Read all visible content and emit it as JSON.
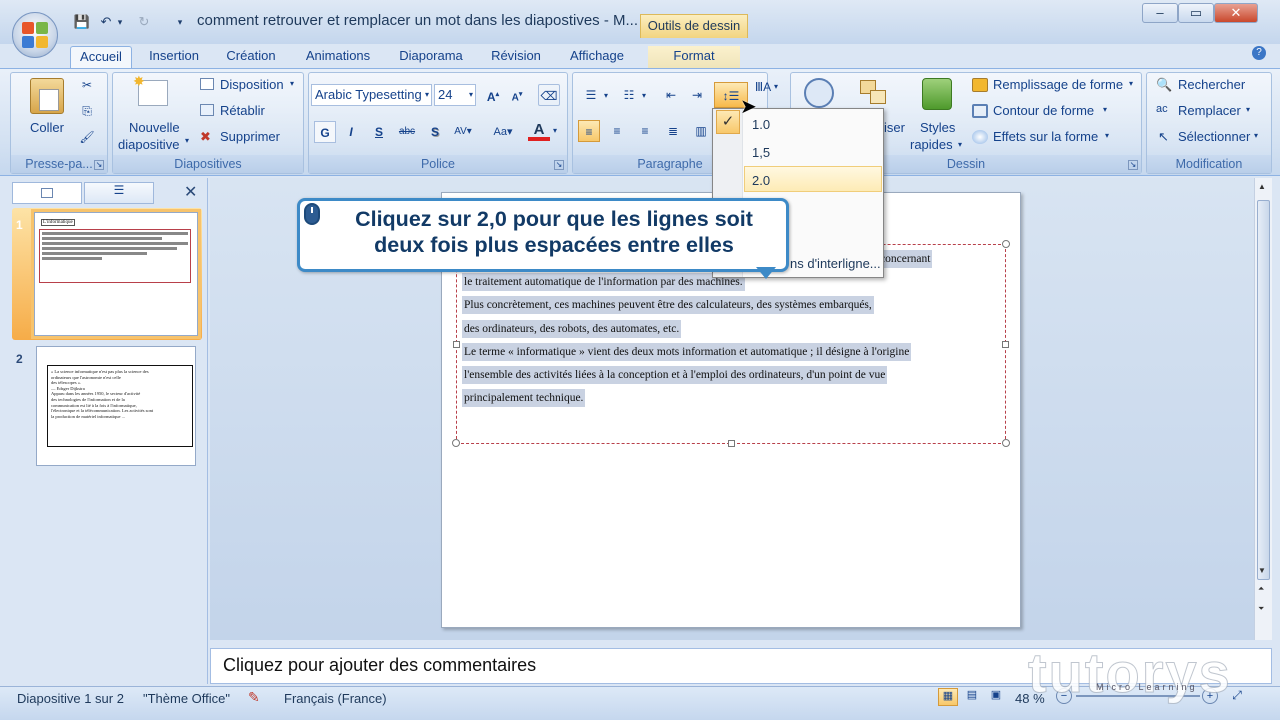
{
  "window": {
    "title": "comment retrouver et remplacer un mot dans les diapostives - M...",
    "context_tab_title": "Outils de dessin",
    "minimize": "‒",
    "maximize": "▭",
    "close": "✕"
  },
  "qat": {
    "save": "💾",
    "undo": "↶",
    "undo_arrow": "▾",
    "redo": "↻",
    "customize": "▾"
  },
  "tabs": [
    "Accueil",
    "Insertion",
    "Création",
    "Animations",
    "Diaporama",
    "Révision",
    "Affichage",
    "Format"
  ],
  "help_icon": "?",
  "ribbon": {
    "clipboard": {
      "paste": "Coller",
      "group": "Presse-pa..."
    },
    "slides": {
      "new_line1": "Nouvelle",
      "new_line2": "diapositive",
      "layout": "Disposition",
      "reset": "Rétablir",
      "delete": "Supprimer",
      "group": "Diapositives"
    },
    "font": {
      "family": "Arabic Typesetting",
      "size": "24",
      "group": "Police"
    },
    "paragraph": {
      "group": "Paragraphe"
    },
    "drawing": {
      "arrange_partial": "iser",
      "styles_line1": "Styles",
      "styles_line2": "rapides",
      "fill": "Remplissage de forme",
      "outline": "Contour de forme",
      "effects": "Effets sur la forme",
      "group": "Dessin"
    },
    "editing": {
      "find": "Rechercher",
      "replace": "Remplacer",
      "select": "Sélectionner",
      "group": "Modification"
    }
  },
  "line_spacing_menu": {
    "items": [
      "1.0",
      "1,5",
      "2.0"
    ],
    "options_partial": "ns d'interligne...",
    "checked": "1.0"
  },
  "callout": {
    "line1": "Cliquez sur 2,0 pour que les lignes soit",
    "line2": "deux fois plus espacées entre elles"
  },
  "slide": {
    "lines": [
      "concernant",
      "le traitement automatique de l'information par des machines.",
      "Plus concrètement, ces machines peuvent être des calculateurs,  des systèmes embarqués,",
      "des ordinateurs, des robots, des automates, etc.",
      "Le terme « informatique » vient des deux mots information et automatique ; il désigne à l'origine",
      "l'ensemble des activités liées à la conception et à l'emploi des ordinateurs, d'un point de vue",
      "principalement technique."
    ]
  },
  "thumbnails": {
    "num1": "1",
    "num2": "2",
    "t1_title": "L'informatique",
    "t2_lines": [
      "« La science informatique n'est pas plus la science des",
      "ordinateurs que l'astronomie n'est celle",
      "des télescopes ».",
      "— Edsger Dijkstra",
      "Apparu dans les années 1950,  le secteur d'activité",
      "des technologies de l'information et de la",
      "communication est lié à la fois à l'informatique,",
      "l'électronique et la télécommunication. Les activités sont",
      "la production de matériel informatique ..."
    ]
  },
  "notes_placeholder": "Cliquez pour ajouter des commentaires",
  "status": {
    "slide": "Diapositive 1 sur 2",
    "theme": "\"Thème Office\"",
    "language": "Français (France)",
    "zoom": "48 %"
  },
  "watermark": {
    "brand": "tutorys",
    "sub": "Micro Learning"
  }
}
